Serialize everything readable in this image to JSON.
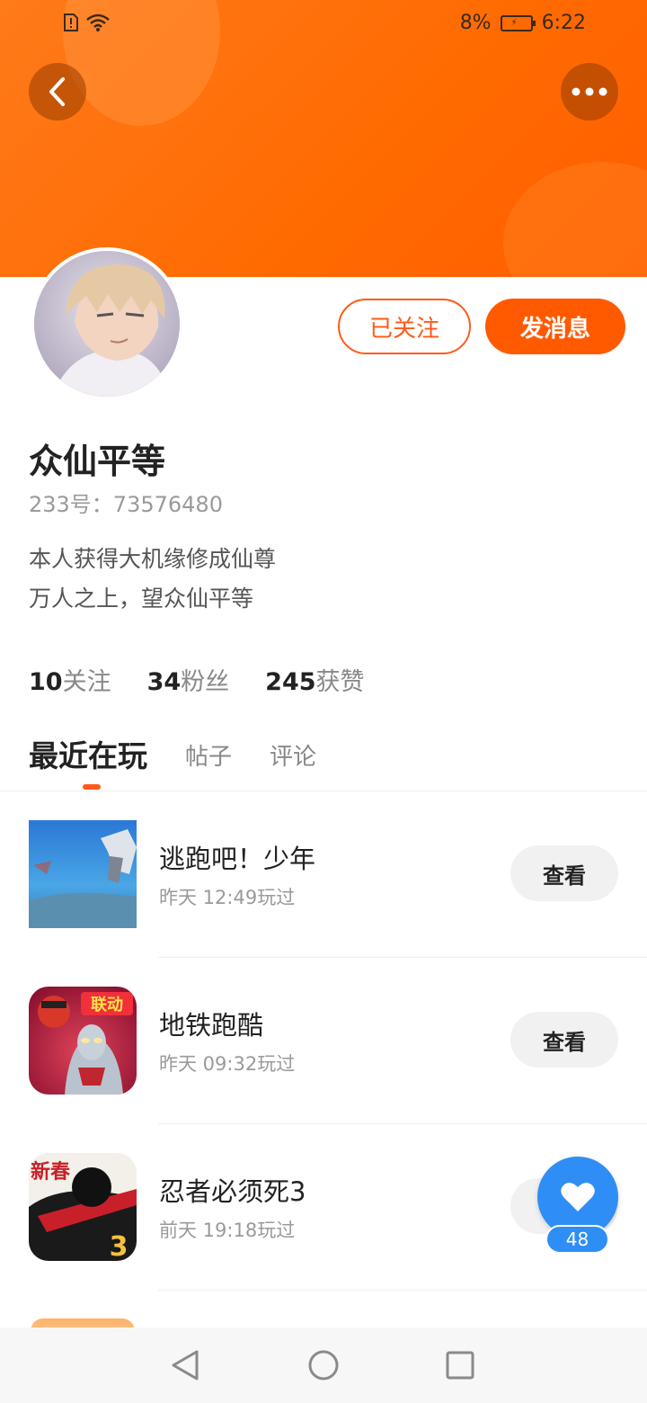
{
  "status_bar": {
    "battery_percent": "8%",
    "time": "6:22"
  },
  "profile": {
    "username": "众仙平等",
    "id_text": "233号：73576480",
    "bio_lines": [
      "本人获得大机缘修成仙尊",
      "万人之上，望众仙平等"
    ],
    "follow_button_label": "已关注",
    "message_button_label": "发消息"
  },
  "stats": [
    {
      "num": "10",
      "label": "关注"
    },
    {
      "num": "34",
      "label": "粉丝"
    },
    {
      "num": "245",
      "label": "获赞"
    }
  ],
  "tabs": [
    {
      "label": "最近在玩",
      "active": true
    },
    {
      "label": "帖子",
      "active": false
    },
    {
      "label": "评论",
      "active": false
    }
  ],
  "games": [
    {
      "name": "逃跑吧！少年",
      "time": "昨天 12:49玩过",
      "button": "查看"
    },
    {
      "name": "地铁跑酷",
      "time": "昨天 09:32玩过",
      "button": "查看"
    },
    {
      "name": "忍者必须死3",
      "time": "前天 19:18玩过",
      "button": "查看"
    }
  ],
  "like_fab": {
    "count": "48"
  },
  "thumb_text": {
    "subway": "联动",
    "ninja_top": "新春",
    "ninja_num": "3"
  },
  "colors": {
    "accent": "#ff5a00",
    "like_blue": "#2f8ef5"
  }
}
